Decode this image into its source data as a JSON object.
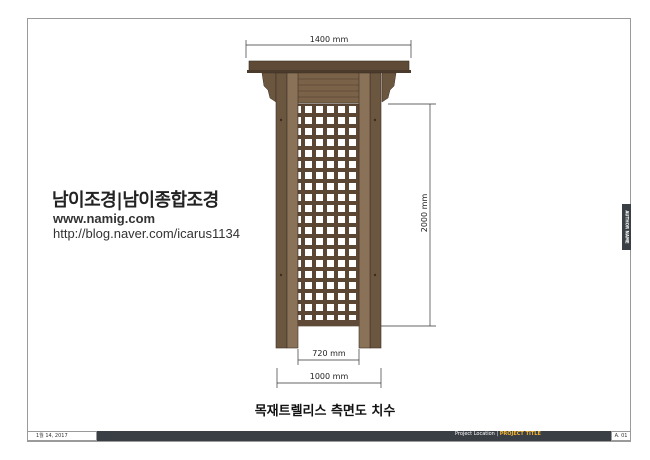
{
  "drawing": {
    "dims": {
      "top_width": "1400 mm",
      "height": "2000 mm",
      "inner_width": "720 mm",
      "base_width": "1000 mm"
    },
    "caption": "목재트렐리스 측면도 치수"
  },
  "brand": {
    "korean": "남이조경|남이종합조경",
    "website": "www.namig.com",
    "blog": "http://blog.naver.com/icarus1134"
  },
  "titleblock": {
    "date": "1월 14, 2017",
    "project_location": "Project Location",
    "separator": " | ",
    "project_title": "PROJECT TITLE",
    "page": "A. 01",
    "author": "AUTHOR NAME"
  },
  "colors": {
    "wood_dark": "#4a3b2c",
    "wood_mid": "#6b5640",
    "wood_light": "#8a7258",
    "strip": "#3a3f45",
    "accent": "#f2b632"
  }
}
